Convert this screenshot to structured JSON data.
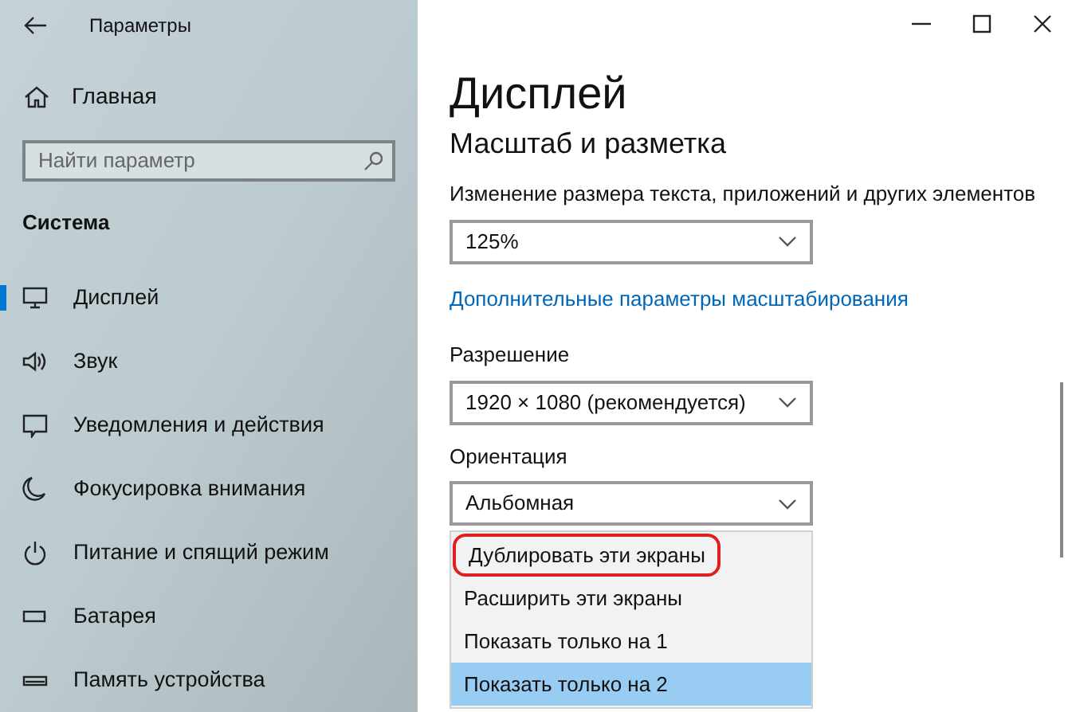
{
  "window": {
    "title": "Параметры"
  },
  "sidebar": {
    "home": "Главная",
    "search": {
      "placeholder": "Найти параметр"
    },
    "section": "Система",
    "items": [
      {
        "label": "Дисплей",
        "selected": true
      },
      {
        "label": "Звук",
        "selected": false
      },
      {
        "label": "Уведомления и действия",
        "selected": false
      },
      {
        "label": "Фокусировка внимания",
        "selected": false
      },
      {
        "label": "Питание и спящий режим",
        "selected": false
      },
      {
        "label": "Батарея",
        "selected": false
      },
      {
        "label": "Память устройства",
        "selected": false
      }
    ]
  },
  "content": {
    "title": "Дисплей",
    "subtitle": "Масштаб и разметка",
    "settings": [
      {
        "kind": "dropdown",
        "label": "Изменение размера текста, приложений и других элементов",
        "value": "125%"
      },
      {
        "kind": "link",
        "label": "Дополнительные параметры масштабирования"
      },
      {
        "kind": "dropdown",
        "label": "Разрешение",
        "value": "1920 × 1080 (рекомендуется)"
      },
      {
        "kind": "dropdown",
        "label": "Ориентация",
        "value": "Альбомная"
      }
    ],
    "menu": [
      {
        "label": "Дублировать эти экраны",
        "selected": false,
        "highlighted": true
      },
      {
        "label": "Расширить эти экраны",
        "selected": false,
        "highlighted": false
      },
      {
        "label": "Показать только на 1",
        "selected": false,
        "highlighted": false
      },
      {
        "label": "Показать только на 2",
        "selected": true,
        "highlighted": false
      }
    ]
  }
}
